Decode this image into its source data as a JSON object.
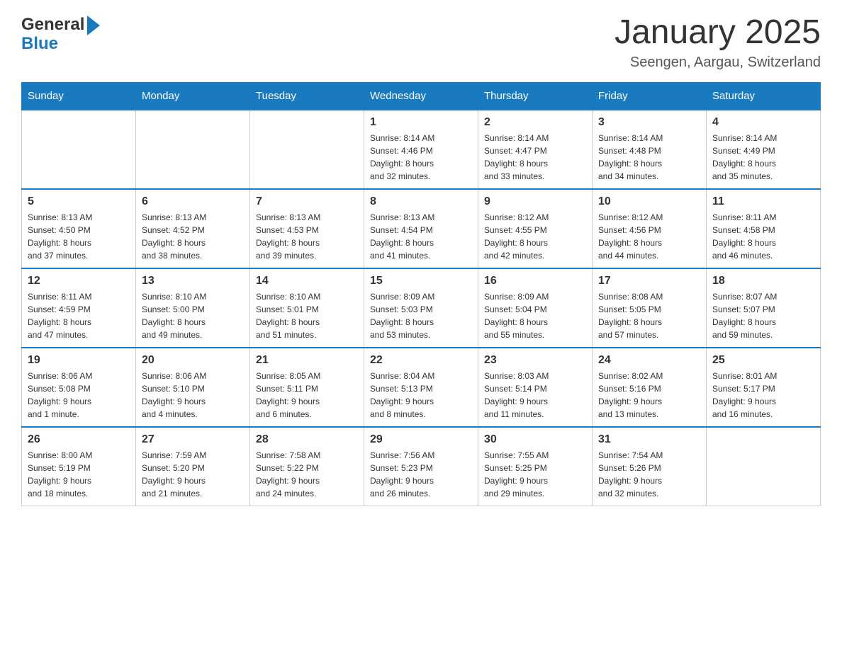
{
  "header": {
    "logo_general": "General",
    "logo_blue": "Blue",
    "title": "January 2025",
    "subtitle": "Seengen, Aargau, Switzerland"
  },
  "days_of_week": [
    "Sunday",
    "Monday",
    "Tuesday",
    "Wednesday",
    "Thursday",
    "Friday",
    "Saturday"
  ],
  "weeks": [
    [
      {
        "day": "",
        "info": ""
      },
      {
        "day": "",
        "info": ""
      },
      {
        "day": "",
        "info": ""
      },
      {
        "day": "1",
        "info": "Sunrise: 8:14 AM\nSunset: 4:46 PM\nDaylight: 8 hours\nand 32 minutes."
      },
      {
        "day": "2",
        "info": "Sunrise: 8:14 AM\nSunset: 4:47 PM\nDaylight: 8 hours\nand 33 minutes."
      },
      {
        "day": "3",
        "info": "Sunrise: 8:14 AM\nSunset: 4:48 PM\nDaylight: 8 hours\nand 34 minutes."
      },
      {
        "day": "4",
        "info": "Sunrise: 8:14 AM\nSunset: 4:49 PM\nDaylight: 8 hours\nand 35 minutes."
      }
    ],
    [
      {
        "day": "5",
        "info": "Sunrise: 8:13 AM\nSunset: 4:50 PM\nDaylight: 8 hours\nand 37 minutes."
      },
      {
        "day": "6",
        "info": "Sunrise: 8:13 AM\nSunset: 4:52 PM\nDaylight: 8 hours\nand 38 minutes."
      },
      {
        "day": "7",
        "info": "Sunrise: 8:13 AM\nSunset: 4:53 PM\nDaylight: 8 hours\nand 39 minutes."
      },
      {
        "day": "8",
        "info": "Sunrise: 8:13 AM\nSunset: 4:54 PM\nDaylight: 8 hours\nand 41 minutes."
      },
      {
        "day": "9",
        "info": "Sunrise: 8:12 AM\nSunset: 4:55 PM\nDaylight: 8 hours\nand 42 minutes."
      },
      {
        "day": "10",
        "info": "Sunrise: 8:12 AM\nSunset: 4:56 PM\nDaylight: 8 hours\nand 44 minutes."
      },
      {
        "day": "11",
        "info": "Sunrise: 8:11 AM\nSunset: 4:58 PM\nDaylight: 8 hours\nand 46 minutes."
      }
    ],
    [
      {
        "day": "12",
        "info": "Sunrise: 8:11 AM\nSunset: 4:59 PM\nDaylight: 8 hours\nand 47 minutes."
      },
      {
        "day": "13",
        "info": "Sunrise: 8:10 AM\nSunset: 5:00 PM\nDaylight: 8 hours\nand 49 minutes."
      },
      {
        "day": "14",
        "info": "Sunrise: 8:10 AM\nSunset: 5:01 PM\nDaylight: 8 hours\nand 51 minutes."
      },
      {
        "day": "15",
        "info": "Sunrise: 8:09 AM\nSunset: 5:03 PM\nDaylight: 8 hours\nand 53 minutes."
      },
      {
        "day": "16",
        "info": "Sunrise: 8:09 AM\nSunset: 5:04 PM\nDaylight: 8 hours\nand 55 minutes."
      },
      {
        "day": "17",
        "info": "Sunrise: 8:08 AM\nSunset: 5:05 PM\nDaylight: 8 hours\nand 57 minutes."
      },
      {
        "day": "18",
        "info": "Sunrise: 8:07 AM\nSunset: 5:07 PM\nDaylight: 8 hours\nand 59 minutes."
      }
    ],
    [
      {
        "day": "19",
        "info": "Sunrise: 8:06 AM\nSunset: 5:08 PM\nDaylight: 9 hours\nand 1 minute."
      },
      {
        "day": "20",
        "info": "Sunrise: 8:06 AM\nSunset: 5:10 PM\nDaylight: 9 hours\nand 4 minutes."
      },
      {
        "day": "21",
        "info": "Sunrise: 8:05 AM\nSunset: 5:11 PM\nDaylight: 9 hours\nand 6 minutes."
      },
      {
        "day": "22",
        "info": "Sunrise: 8:04 AM\nSunset: 5:13 PM\nDaylight: 9 hours\nand 8 minutes."
      },
      {
        "day": "23",
        "info": "Sunrise: 8:03 AM\nSunset: 5:14 PM\nDaylight: 9 hours\nand 11 minutes."
      },
      {
        "day": "24",
        "info": "Sunrise: 8:02 AM\nSunset: 5:16 PM\nDaylight: 9 hours\nand 13 minutes."
      },
      {
        "day": "25",
        "info": "Sunrise: 8:01 AM\nSunset: 5:17 PM\nDaylight: 9 hours\nand 16 minutes."
      }
    ],
    [
      {
        "day": "26",
        "info": "Sunrise: 8:00 AM\nSunset: 5:19 PM\nDaylight: 9 hours\nand 18 minutes."
      },
      {
        "day": "27",
        "info": "Sunrise: 7:59 AM\nSunset: 5:20 PM\nDaylight: 9 hours\nand 21 minutes."
      },
      {
        "day": "28",
        "info": "Sunrise: 7:58 AM\nSunset: 5:22 PM\nDaylight: 9 hours\nand 24 minutes."
      },
      {
        "day": "29",
        "info": "Sunrise: 7:56 AM\nSunset: 5:23 PM\nDaylight: 9 hours\nand 26 minutes."
      },
      {
        "day": "30",
        "info": "Sunrise: 7:55 AM\nSunset: 5:25 PM\nDaylight: 9 hours\nand 29 minutes."
      },
      {
        "day": "31",
        "info": "Sunrise: 7:54 AM\nSunset: 5:26 PM\nDaylight: 9 hours\nand 32 minutes."
      },
      {
        "day": "",
        "info": ""
      }
    ]
  ]
}
